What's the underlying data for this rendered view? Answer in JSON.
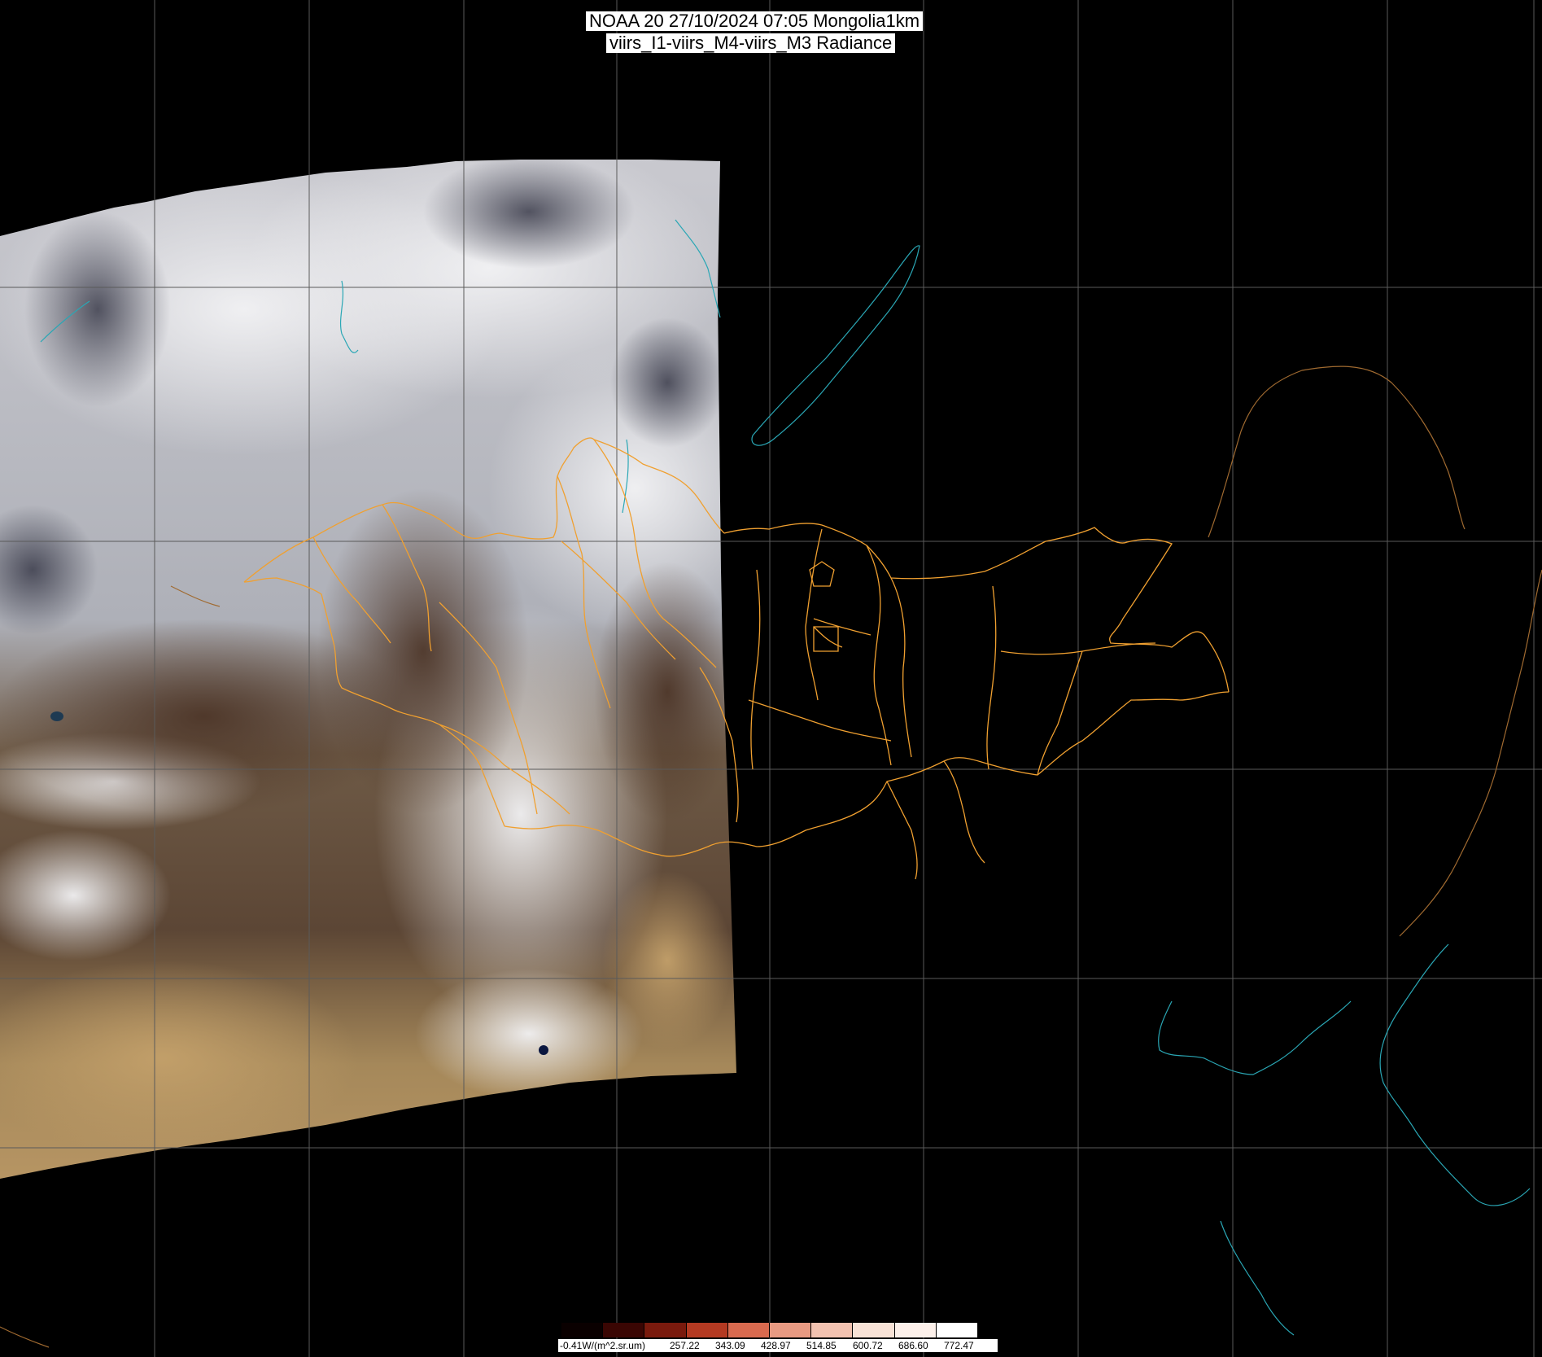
{
  "title": {
    "line1": "NOAA 20 27/10/2024 07:05 Mongolia1km",
    "line2": "viirs_I1-viirs_M4-viirs_M3 Radiance"
  },
  "colorbar": {
    "labels": [
      "-0.41W/(m^2.sr.um)",
      "257.22",
      "343.09",
      "428.97",
      "514.85",
      "600.72",
      "686.60",
      "772.47"
    ],
    "colors": [
      "#0a0000",
      "#3a0603",
      "#7a1a0d",
      "#b43a22",
      "#d86a4f",
      "#e89a82",
      "#f2c2b0",
      "#f8e2d6",
      "#fcf0ea",
      "#ffffff"
    ]
  },
  "colors": {
    "background": "#000000",
    "gridline": "#5a5a5a",
    "boundary": "#f0a030",
    "coastline": "#2aa7b5",
    "country_border": "#a06a30"
  }
}
